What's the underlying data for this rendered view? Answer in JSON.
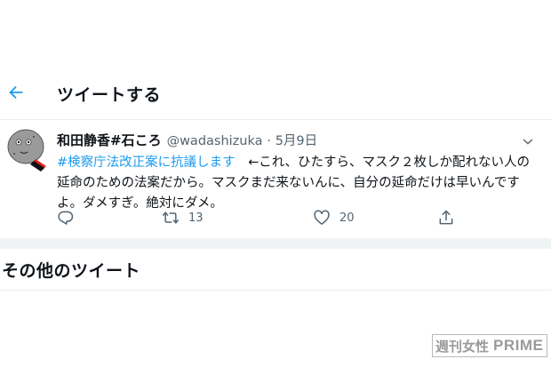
{
  "header": {
    "back_icon": "arrow-left-icon",
    "title": "ツイートする"
  },
  "tweet": {
    "display_name": "和田静香#石ころ",
    "handle": "@wadashizuka",
    "separator": "·",
    "date": "5月9日",
    "more_icon": "chevron-down-icon",
    "hashtag": "#検察庁法改正案に抗議します",
    "text_after_hashtag": "　←これ、ひたすら、マスク２枚しか配れない人の延命のための法案だから。マスクまだ来ないんに、自分の延命だけは早いんですよ。ダメすぎ。絶対にダメ。",
    "actions": {
      "reply_icon": "reply-icon",
      "retweet_icon": "retweet-icon",
      "retweet_count": "13",
      "like_icon": "heart-icon",
      "like_count": "20",
      "share_icon": "share-icon"
    }
  },
  "more_tweets": {
    "title": "その他のツイート"
  },
  "watermark": {
    "left": "週刊女性",
    "right": "PRIME"
  },
  "colors": {
    "hashtag": "#1d9bf0",
    "secondary_text": "#536471",
    "divider": "#eff3f4"
  }
}
